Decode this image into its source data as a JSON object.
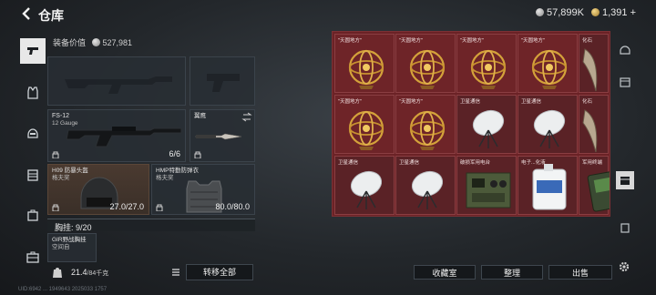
{
  "header": {
    "title": "仓库",
    "currency_silver": "57,899K",
    "currency_gold": "1,391",
    "add_symbol": "+"
  },
  "equipment": {
    "value_label": "装备价值",
    "value": "527,981",
    "primary_weapon": {
      "name": "FS-12",
      "caliber": "12 Gauge",
      "ammo": "6/6"
    },
    "melee": {
      "name": "翼鹰"
    },
    "helmet": {
      "name": "H09 防暴头盔",
      "tag": "格夫奖",
      "durability": "27.0/27.0"
    },
    "armor": {
      "name": "HMP特勤防弹衣",
      "tag": "格夫奖",
      "durability": "80.0/80.0"
    },
    "pocket": {
      "label": "胸挂",
      "value": "9/20"
    },
    "rig": {
      "name": "GIR野战胸挂",
      "tag": "空间自"
    }
  },
  "bottom": {
    "weight": "21.4",
    "weight_max": "/84千克",
    "transfer_all": "转移全部",
    "collection": "收藏室",
    "sort": "整理",
    "sell": "出售"
  },
  "inventory": {
    "cells": [
      {
        "label": "\"天圆地方\"",
        "item": "armillary"
      },
      {
        "label": "\"天圆地方\"",
        "item": "armillary"
      },
      {
        "label": "\"天圆地方\"",
        "item": "armillary"
      },
      {
        "label": "\"天圆地方\"",
        "item": "armillary"
      },
      {
        "label": "化石",
        "item": "fossil"
      },
      {
        "label": "\"天圆地方\"",
        "item": "armillary"
      },
      {
        "label": "\"天圆地方\"",
        "item": "armillary"
      },
      {
        "label": "卫星通信",
        "item": "dish"
      },
      {
        "label": "卫星通信",
        "item": "dish"
      },
      {
        "label": "化石",
        "item": "fossil"
      },
      {
        "label": "卫星通信",
        "item": "dish"
      },
      {
        "label": "卫星通信",
        "item": "dish"
      },
      {
        "label": "破损军用电台",
        "item": "radio"
      },
      {
        "label": "电子...化液",
        "item": "jug"
      },
      {
        "label": "军用终端",
        "item": "terminal"
      }
    ]
  },
  "footer": {
    "text": "UID:6942 ... 1949643 2025033 1757"
  },
  "colors": {
    "inventory_bg": "#6b2226",
    "panel_bg": "#282e34",
    "accent_light": "#e8e8e8"
  }
}
